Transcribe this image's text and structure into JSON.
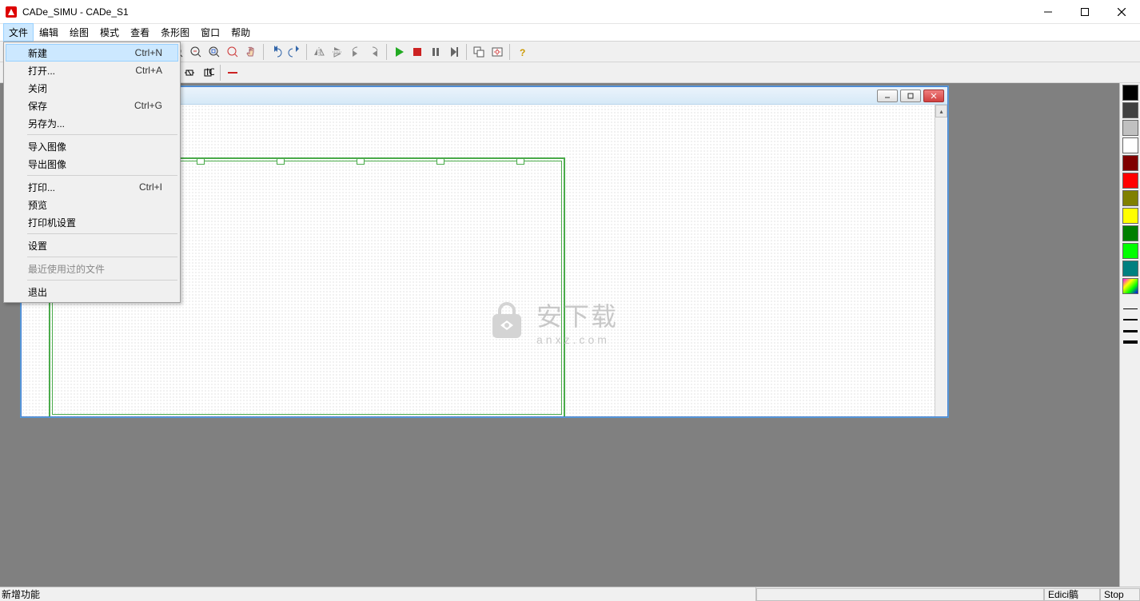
{
  "window": {
    "title": "CADe_SIMU - CADe_S1"
  },
  "menubar": {
    "items": [
      {
        "label": "文件",
        "active": true
      },
      {
        "label": "编辑"
      },
      {
        "label": "绘图"
      },
      {
        "label": "模式"
      },
      {
        "label": "查看"
      },
      {
        "label": "条形图"
      },
      {
        "label": "窗口"
      },
      {
        "label": "帮助"
      }
    ]
  },
  "file_menu": {
    "items": [
      {
        "label": "新建",
        "shortcut": "Ctrl+N",
        "highlight": true
      },
      {
        "label": "打开...",
        "shortcut": "Ctrl+A"
      },
      {
        "label": "关闭"
      },
      {
        "label": "保存",
        "shortcut": "Ctrl+G"
      },
      {
        "label": "另存为..."
      },
      {
        "sep": true
      },
      {
        "label": "导入图像"
      },
      {
        "label": "导出图像"
      },
      {
        "sep": true
      },
      {
        "label": "打印...",
        "shortcut": "Ctrl+I"
      },
      {
        "label": "预览"
      },
      {
        "label": "打印机设置"
      },
      {
        "sep": true
      },
      {
        "label": "设置"
      },
      {
        "sep": true
      },
      {
        "label": "最近使用过的文件",
        "disabled": true
      },
      {
        "sep": true
      },
      {
        "label": "退出"
      }
    ]
  },
  "palette": {
    "colors": [
      "#000000",
      "#404040",
      "#c0c0c0",
      "#ffffff",
      "#800000",
      "#ff0000",
      "#808000",
      "#ffff00",
      "#008000",
      "#00ff00",
      "#008080"
    ],
    "rainbow": true,
    "line_weights": [
      1,
      2,
      3,
      4
    ]
  },
  "statusbar": {
    "left": "新增功能",
    "mode": "Edici髇",
    "state": "Stop"
  },
  "watermark": {
    "text": "安下载",
    "sub": "anxz.com"
  }
}
